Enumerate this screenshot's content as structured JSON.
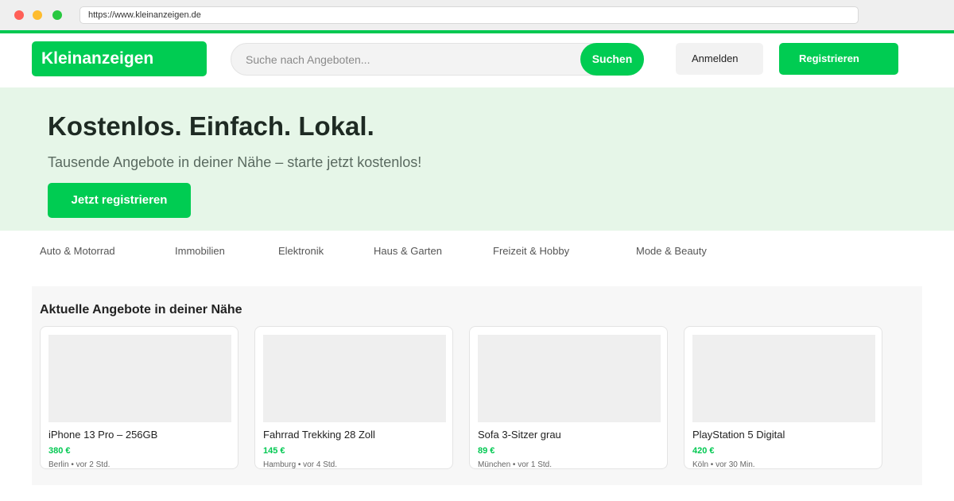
{
  "browser": {
    "url": "https://www.kleinanzeigen.de"
  },
  "header": {
    "logo": "Kleinanzeigen",
    "search_placeholder": "Suche nach Angeboten...",
    "search_button": "Suchen",
    "login_button": "Anmelden",
    "register_button": "Registrieren"
  },
  "hero": {
    "title": "Kostenlos. Einfach. Lokal.",
    "subtitle": "Tausende Angebote in deiner Nähe – starte jetzt kostenlos!",
    "cta": "Jetzt registrieren"
  },
  "categories": [
    "Auto & Motorrad",
    "Immobilien",
    "Elektronik",
    "Haus & Garten",
    "Freizeit & Hobby",
    "Mode & Beauty"
  ],
  "offers": {
    "title": "Aktuelle Angebote in deiner Nähe",
    "items": [
      {
        "title": "iPhone 13 Pro – 256GB",
        "price": "380 €",
        "meta": "Berlin • vor 2 Std."
      },
      {
        "title": "Fahrrad Trekking 28 Zoll",
        "price": "145 €",
        "meta": "Hamburg • vor 4 Std."
      },
      {
        "title": "Sofa 3-Sitzer grau",
        "price": "89 €",
        "meta": "München • vor 1 Std."
      },
      {
        "title": "PlayStation 5 Digital",
        "price": "420 €",
        "meta": "Köln • vor 30 Min."
      }
    ]
  },
  "colors": {
    "brand": "#00cc52",
    "hero_bg": "#e6f6e8"
  }
}
